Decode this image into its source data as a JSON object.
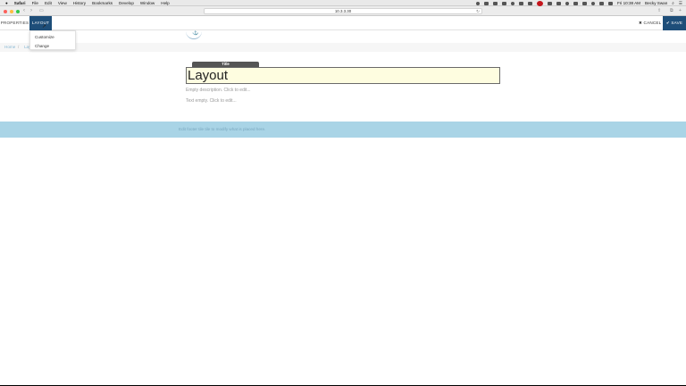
{
  "menubar": {
    "apple": "",
    "items": [
      "Safari",
      "File",
      "Edit",
      "View",
      "History",
      "Bookmarks",
      "Develop",
      "Window",
      "Help"
    ],
    "clock": "Fri 10:38 AM",
    "user": "Becky Swan"
  },
  "browser": {
    "url": "10.3.3.30",
    "reload_glyph": "↻"
  },
  "toolbar": {
    "properties_label": "PROPERTIES",
    "layout_label": "LAYOUT",
    "cancel_label": "CANCEL",
    "cancel_icon": "✖",
    "save_label": "SAVE",
    "save_icon": "✔"
  },
  "layout_menu": {
    "items": [
      "Customize",
      "Change"
    ]
  },
  "breadcrumb": {
    "home": "Home",
    "separator": "/",
    "current": "Lay"
  },
  "editor": {
    "title_tag": "Title",
    "title": "Layout",
    "description_placeholder": "Empty description. Click to edit...",
    "text_placeholder": "Text empty. Click to edit..."
  },
  "footer": {
    "hint": "Edit footer tile tile to modify what is placed here."
  },
  "colors": {
    "brand": "#1e4e79",
    "title_bg": "#fefde0",
    "footer_bg": "#a9d4e6",
    "link": "#87b7d3"
  }
}
